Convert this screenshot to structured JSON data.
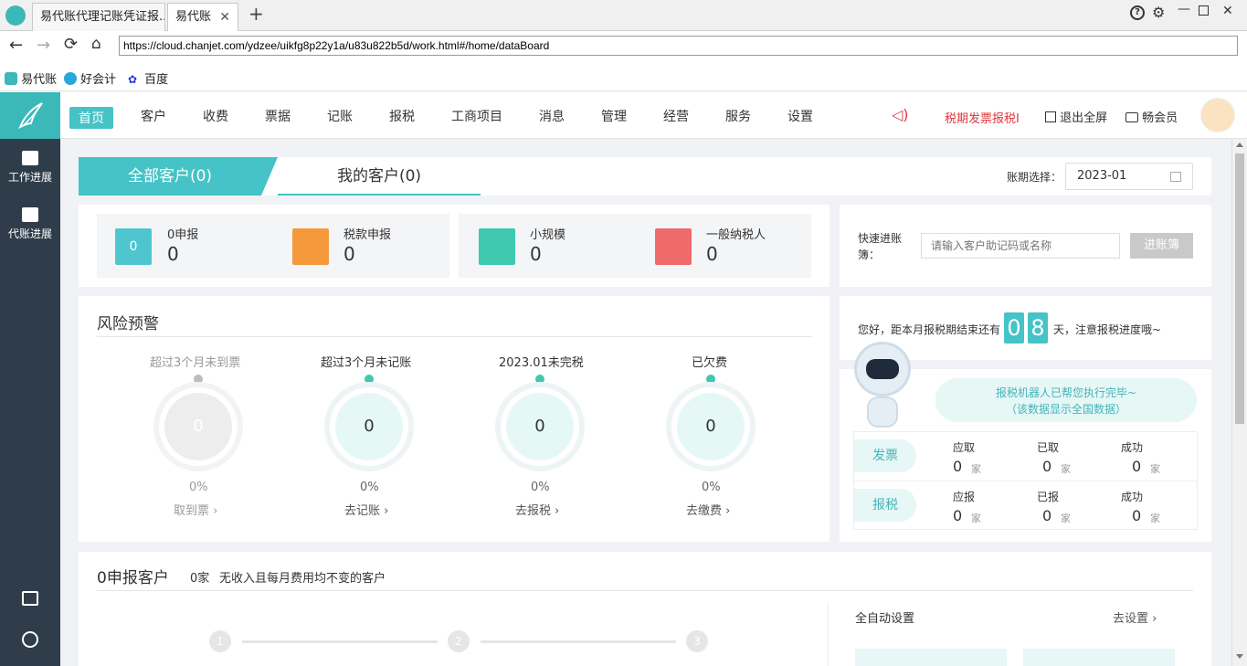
{
  "browser": {
    "tabs": [
      {
        "label": "易代账代理记账凭证报.."
      },
      {
        "label": "易代账"
      }
    ],
    "url": "https://cloud.chanjet.com/ydzee/uikfg8p22y1a/u83u822b5d/work.html#/home/dataBoard",
    "bookmarks": [
      "易代账",
      "好会计",
      "百度"
    ]
  },
  "sidebar": {
    "items": [
      {
        "label": "工作进展"
      },
      {
        "label": "代账进展"
      }
    ]
  },
  "topnav": {
    "items": [
      "首页",
      "客户",
      "收费",
      "票据",
      "记账",
      "报税",
      "工商项目",
      "消息",
      "管理",
      "经营",
      "服务",
      "设置"
    ],
    "notice": "税期发票报税I",
    "exit_fullscreen": "退出全屏",
    "member": "畅会员"
  },
  "customer_tabs": {
    "all": "全部客户(0)",
    "mine": "我的客户(0)",
    "period_label": "账期选择：",
    "period_value": "2023-01"
  },
  "summary": [
    {
      "label": "0申报",
      "value": "0",
      "color": "#4fc6cf",
      "icon": "0"
    },
    {
      "label": "税款申报",
      "value": "0",
      "color": "#f59a3c",
      "icon": "doc-icon"
    },
    {
      "label": "小规模",
      "value": "0",
      "color": "#3ec9b0",
      "icon": "user-icon"
    },
    {
      "label": "一般纳税人",
      "value": "0",
      "color": "#ef6a6a",
      "icon": "user-icon"
    }
  ],
  "quick": {
    "label_line1": "快速进账",
    "label_line2": "簿：",
    "placeholder": "请输入客户助记码或名称",
    "button": "进账簿"
  },
  "risk": {
    "title": "风险预警",
    "items": [
      {
        "title": "超过3个月未到票",
        "value": "0",
        "percent": "0%",
        "action": "取到票",
        "active": false
      },
      {
        "title": "超过3个月未记账",
        "value": "0",
        "percent": "0%",
        "action": "去记账",
        "active": true
      },
      {
        "title": "2023.01未完税",
        "value": "0",
        "percent": "0%",
        "action": "去报税",
        "active": true
      },
      {
        "title": "已欠费",
        "value": "0",
        "percent": "0%",
        "action": "去缴费",
        "active": true
      }
    ]
  },
  "deadline": {
    "prefix": "您好，距本月报税期结束还有",
    "digit1": "0",
    "digit2": "8",
    "suffix": "天，注意报税进度哦~"
  },
  "robot": {
    "msg1": "报税机器人已帮您执行完毕~",
    "msg2": "（该数据显示全国数据）",
    "rows": [
      {
        "tag": "发票",
        "cols": [
          {
            "label": "应取",
            "value": "0",
            "unit": "家"
          },
          {
            "label": "已取",
            "value": "0",
            "unit": "家"
          },
          {
            "label": "成功",
            "value": "0",
            "unit": "家"
          }
        ]
      },
      {
        "tag": "报税",
        "cols": [
          {
            "label": "应报",
            "value": "0",
            "unit": "家"
          },
          {
            "label": "已报",
            "value": "0",
            "unit": "家"
          },
          {
            "label": "成功",
            "value": "0",
            "unit": "家"
          }
        ]
      }
    ]
  },
  "zero_report": {
    "title": "0申报客户",
    "count": "0家",
    "desc": "无收入且每月费用均不变的客户",
    "steps": [
      "1",
      "2",
      "3"
    ],
    "auto_title": "全自动设置",
    "auto_link": "去设置"
  },
  "colors": {
    "accent": "#45c3c7",
    "sidebar": "#2f3d4a",
    "notice": "#e0383e"
  }
}
